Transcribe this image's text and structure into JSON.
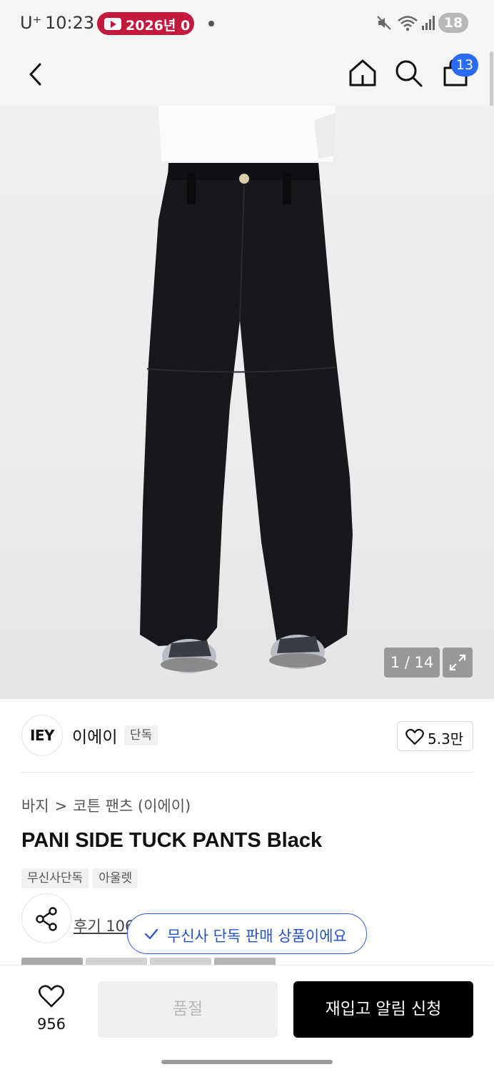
{
  "status_bar": {
    "carrier": "U⁺",
    "time": "10:23",
    "youtube_pill": "2026년 0",
    "battery": "18"
  },
  "nav": {
    "back_icon": "chevron-left-icon",
    "home_icon": "home-icon",
    "search_icon": "search-icon",
    "cart_icon": "shopping-bag-icon",
    "cart_badge": "13",
    "accent_color": "#2b6af5"
  },
  "hero": {
    "counter": "1 / 14",
    "expand_icon": "expand-icon"
  },
  "brand": {
    "logo_text": "IEY",
    "name": "이에이",
    "tag": "단독",
    "like_count": "5.3만"
  },
  "product": {
    "breadcrumb": [
      "바지",
      "코튼 팬츠 (이에이)"
    ],
    "breadcrumb_sep": ">",
    "title": "PANI SIDE TUCK PANTS Black",
    "tags": [
      "무신사단독",
      "아울렛"
    ],
    "review_link": "후기 106"
  },
  "toast": {
    "text": "무신사 단독 판매 상품이에요",
    "color": "#2452c9"
  },
  "bottom_bar": {
    "wish_count": "956",
    "soldout_label": "품절",
    "restock_label": "재입고 알림 신청"
  }
}
